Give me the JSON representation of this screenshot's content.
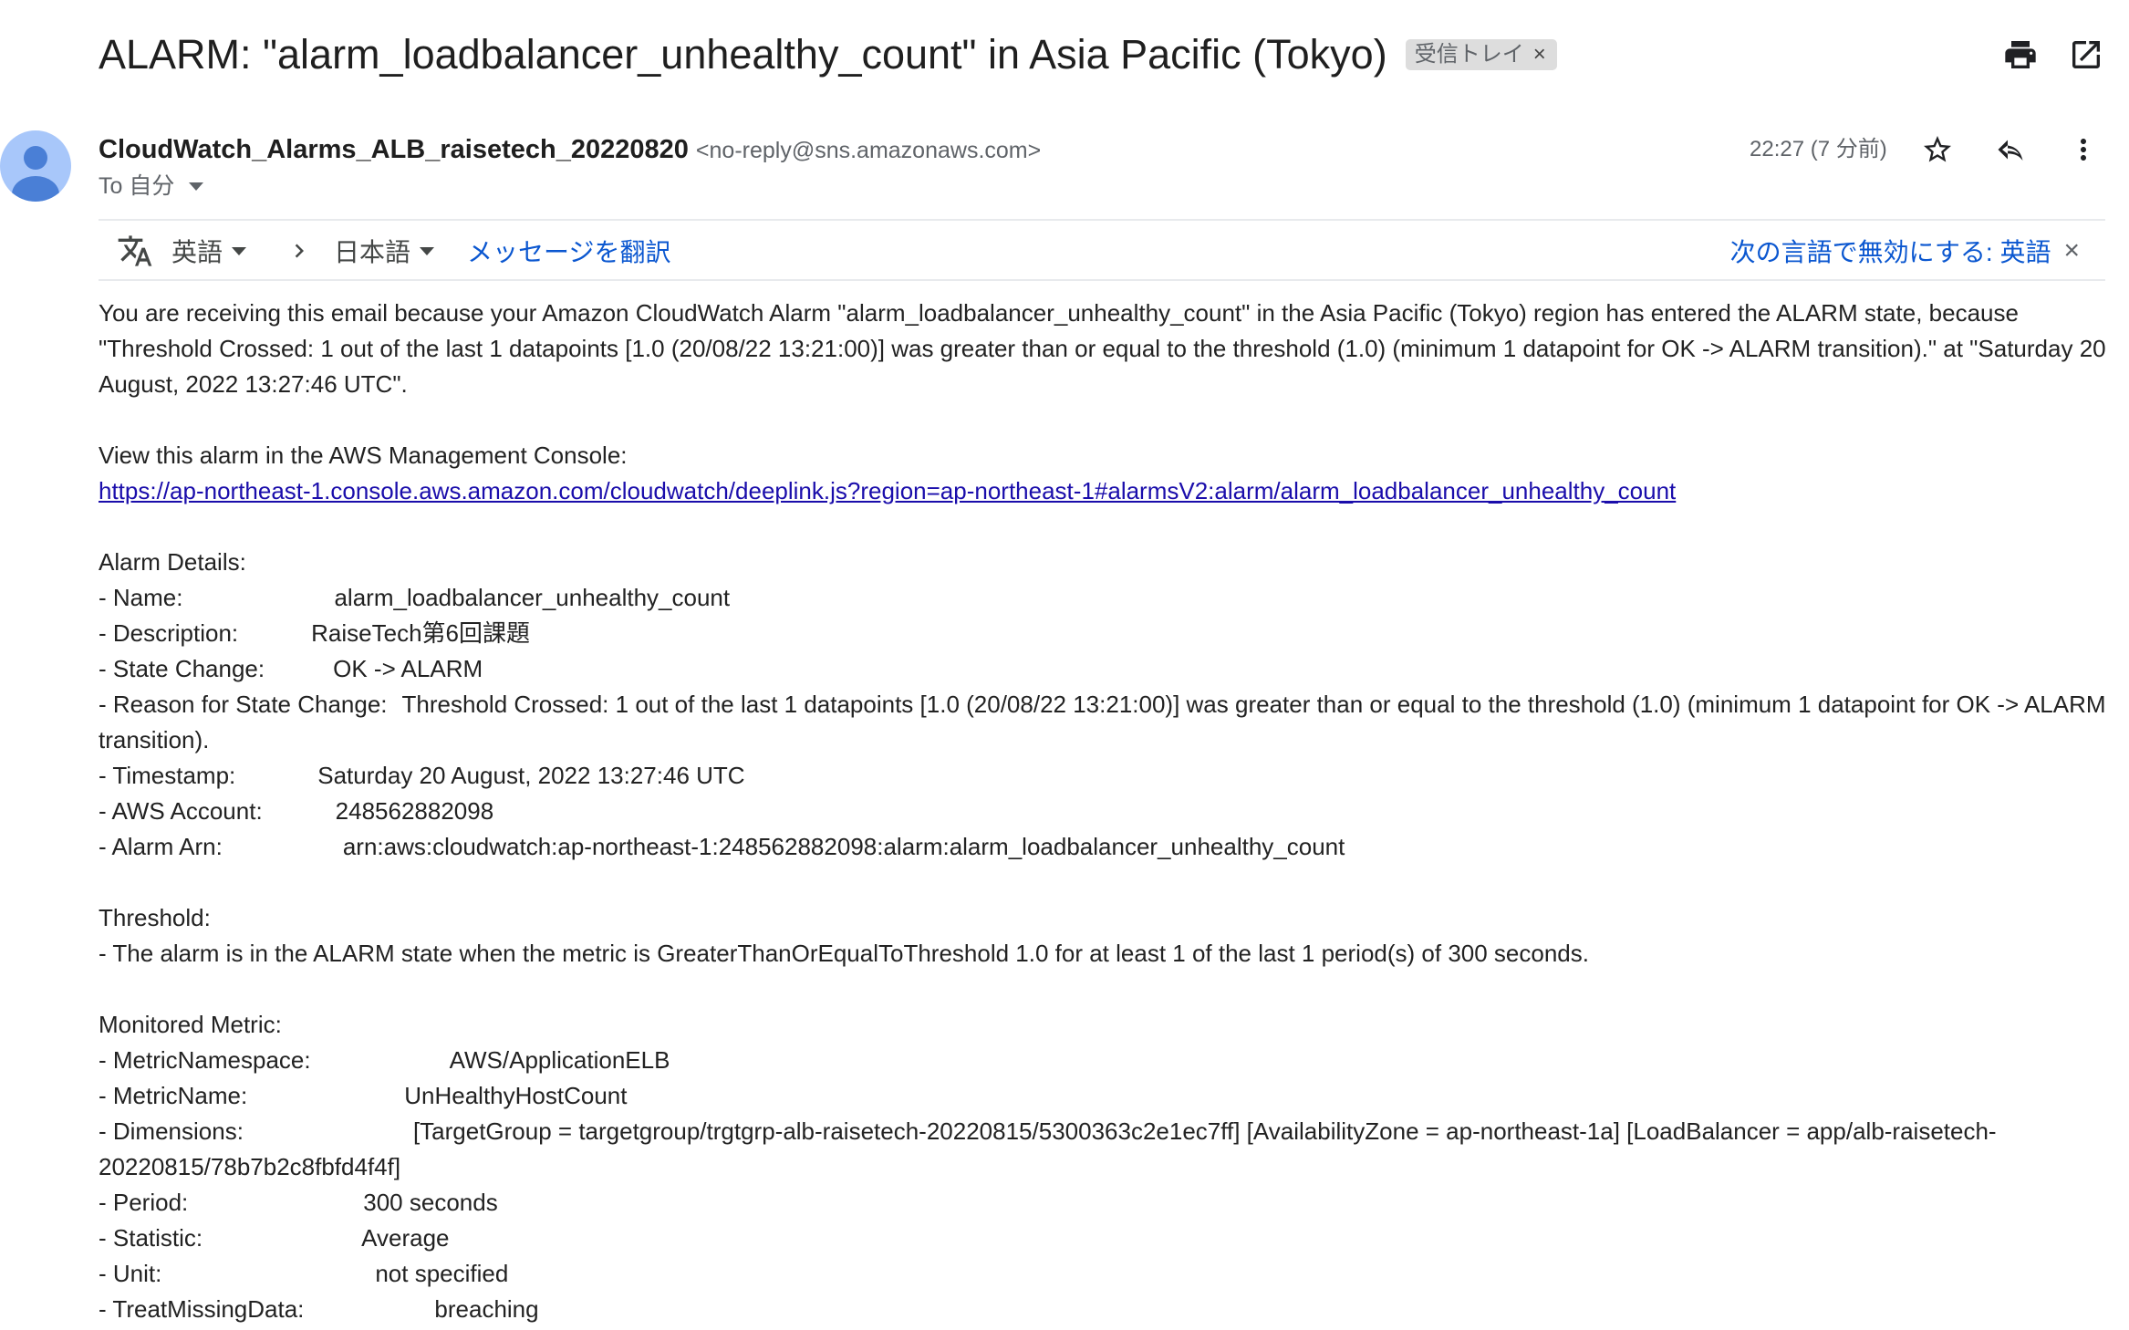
{
  "subject": "ALARM: \"alarm_loadbalancer_unhealthy_count\" in Asia Pacific (Tokyo)",
  "label_chip": {
    "text": "受信トレイ",
    "close": "×"
  },
  "toolbar_icons": [
    "print-icon",
    "open-in-new-window-icon"
  ],
  "sender": {
    "name": "CloudWatch_Alarms_ALB_raisetech_20220820",
    "email": "<no-reply@sns.amazonaws.com>",
    "to": "To 自分",
    "time": "22:27 (7 分前)"
  },
  "actions": [
    "star-icon",
    "reply-icon",
    "more-vert-icon"
  ],
  "translate": {
    "source_lang": "英語",
    "target_lang": "日本語",
    "translate_link": "メッセージを翻訳",
    "disable_link": "次の言語で無効にする: 英語",
    "close": "×"
  },
  "body": {
    "intro": "You are receiving this email because your Amazon CloudWatch Alarm \"alarm_loadbalancer_unhealthy_count\" in the Asia Pacific (Tokyo) region has entered the ALARM state, because \"Threshold Crossed: 1 out of the last 1 datapoints [1.0 (20/08/22 13:21:00)] was greater than or equal to the threshold (1.0) (minimum 1 datapoint for OK -> ALARM transition).\" at \"Saturday 20 August, 2022 13:27:46 UTC\".",
    "console_heading": "View this alarm in the AWS Management Console:",
    "console_url": "https://ap-northeast-1.console.aws.amazon.com/cloudwatch/deeplink.js?region=ap-northeast-1#alarmsV2:alarm/alarm_loadbalancer_unhealthy_count",
    "alarm_details_heading": "Alarm Details:",
    "alarm_details": [
      {
        "key": "- Name:",
        "value": "alarm_loadbalancer_unhealthy_count"
      },
      {
        "key": "- Description:",
        "value": "RaiseTech第6回課題"
      },
      {
        "key": "- State Change:",
        "value": "OK -> ALARM"
      },
      {
        "key": "- Reason for State Change:",
        "value": "Threshold Crossed: 1 out of the last 1 datapoints [1.0 (20/08/22 13:21:00)] was greater than or equal to the threshold (1.0) (minimum 1 datapoint for OK -> ALARM transition)."
      },
      {
        "key": "- Timestamp:",
        "value": "Saturday 20 August, 2022 13:27:46 UTC"
      },
      {
        "key": "- AWS Account:",
        "value": "248562882098"
      },
      {
        "key": "- Alarm Arn:",
        "value": "arn:aws:cloudwatch:ap-northeast-1:248562882098:alarm:alarm_loadbalancer_unhealthy_count"
      }
    ],
    "threshold_heading": "Threshold:",
    "threshold_text": "- The alarm is in the ALARM state when the metric is GreaterThanOrEqualToThreshold 1.0 for at least 1 of the last 1 period(s) of 300 seconds.",
    "metric_heading": "Monitored Metric:",
    "metric_details": [
      {
        "key": "- MetricNamespace:",
        "value": "AWS/ApplicationELB"
      },
      {
        "key": "- MetricName:",
        "value": "UnHealthyHostCount"
      },
      {
        "key": "- Dimensions:",
        "value": "[TargetGroup = targetgroup/trgtgrp-alb-raisetech-20220815/5300363c2e1ec7ff] [AvailabilityZone = ap-northeast-1a] [LoadBalancer = app/alb-raisetech-20220815/78b7b2c8fbfd4f4f]"
      },
      {
        "key": "- Period:",
        "value": "300 seconds"
      },
      {
        "key": "- Statistic:",
        "value": "Average"
      },
      {
        "key": "- Unit:",
        "value": "not specified"
      },
      {
        "key": "- TreatMissingData:",
        "value": "breaching"
      }
    ]
  }
}
